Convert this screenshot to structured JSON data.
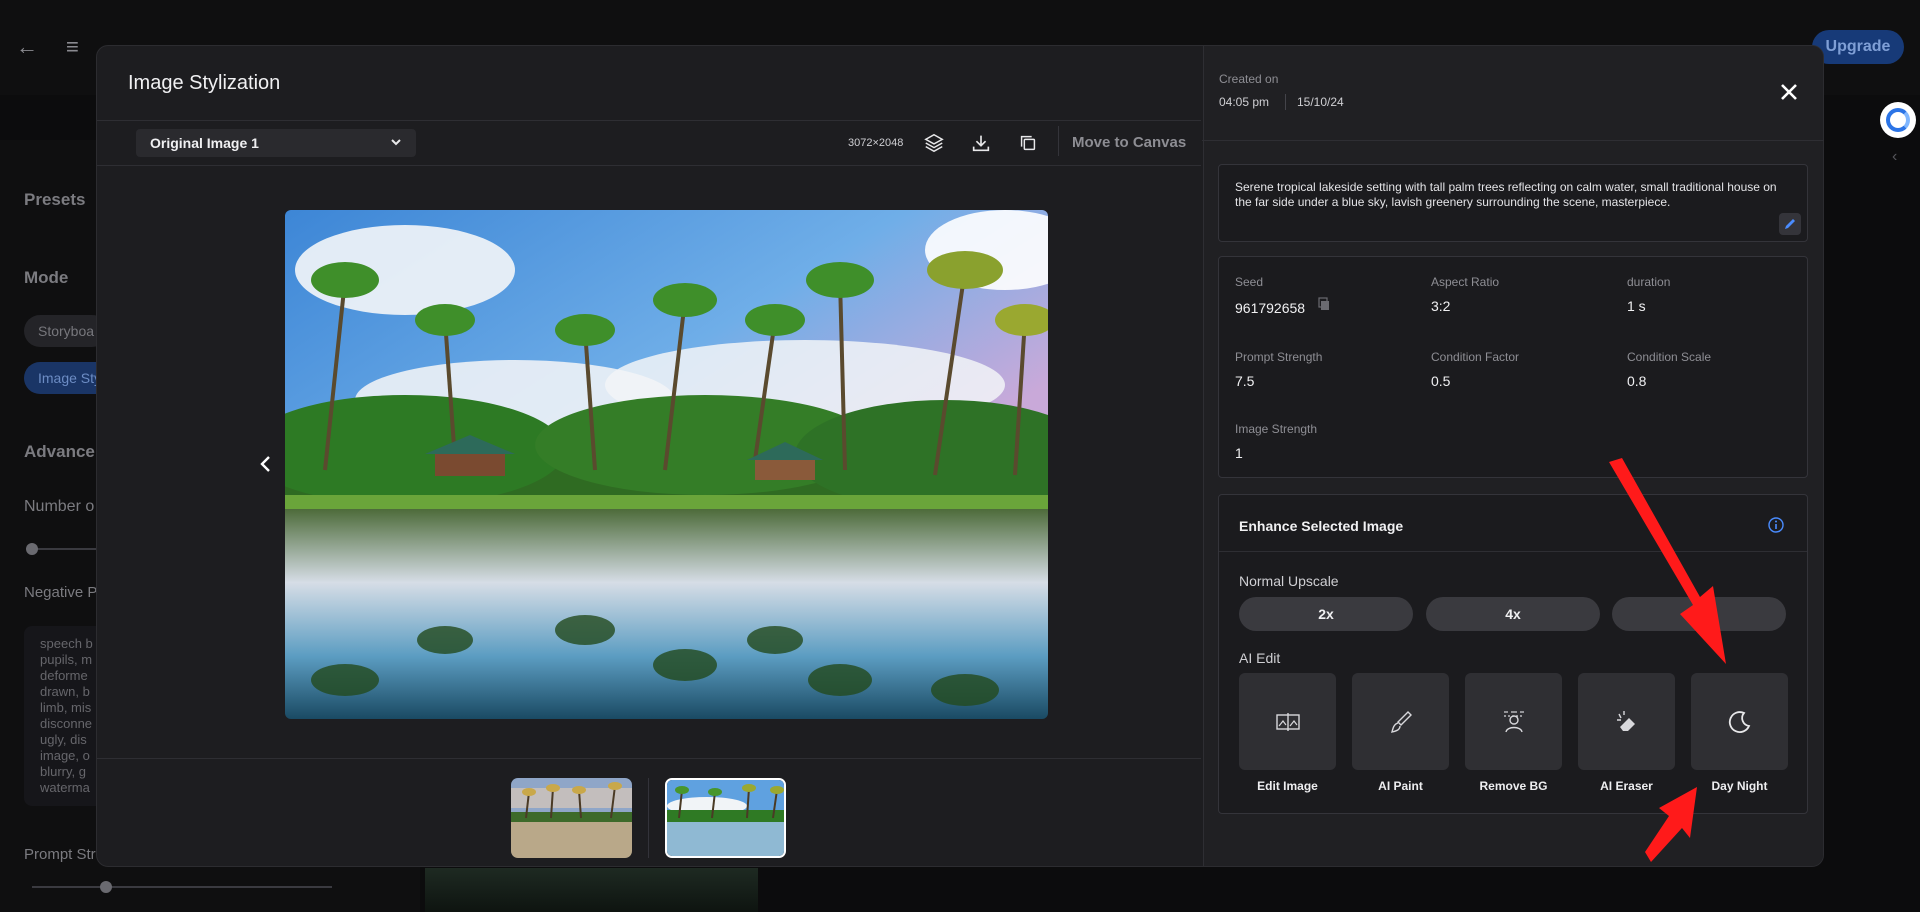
{
  "background": {
    "presets_label": "Presets",
    "mode_label": "Mode",
    "mode_storyboard": "Storyboa",
    "mode_image_stylization": "Image Sty",
    "advanced_label": "Advance",
    "number_label": "Number o",
    "negative_label": "Negative P",
    "negative_text": "speech b\npupils, m\ndeforme\ndrawn, b\nlimb, mis\ndisconne\nugly, dis\nimage, o\nblurry, g\nwaterma",
    "prompt_strength_label": "Prompt Str",
    "upgrade_label": "Upgrade",
    "accent": "#1f4aa0"
  },
  "modal": {
    "title": "Image Stylization",
    "image_selector": {
      "selected": "Original Image 1"
    },
    "dimensions": "3072×2048",
    "toolbar": {
      "layers_icon": "layers-icon",
      "download_icon": "download-icon",
      "copy_icon": "copy-icon",
      "move_to_canvas": "Move to Canvas"
    },
    "created": {
      "label": "Created on",
      "time": "04:05 pm",
      "date": "15/10/24"
    },
    "prompt": "Serene tropical lakeside setting with tall palm trees reflecting on calm water, small traditional house on the far side under a blue sky, lavish greenery surrounding the scene, masterpiece.",
    "params": {
      "seed_label": "Seed",
      "seed_value": "961792658",
      "aspect_label": "Aspect Ratio",
      "aspect_value": "3:2",
      "duration_label": "duration",
      "duration_value": "1 s",
      "prompt_strength_label": "Prompt Strength",
      "prompt_strength_value": "7.5",
      "condition_factor_label": "Condition Factor",
      "condition_factor_value": "0.5",
      "condition_scale_label": "Condition Scale",
      "condition_scale_value": "0.8",
      "image_strength_label": "Image Strength",
      "image_strength_value": "1"
    },
    "enhance": {
      "title": "Enhance Selected Image",
      "upscale_label": "Normal Upscale",
      "upscale_buttons": [
        "2x",
        "4x",
        ""
      ],
      "ai_edit_label": "AI Edit",
      "tools": [
        "Edit Image",
        "AI Paint",
        "Remove BG",
        "AI Eraser",
        "Day Night"
      ]
    },
    "colors": {
      "panel": "#1d1d20",
      "button": "#3a3a3f",
      "info_blue": "#4a8cff",
      "annotation_red": "#ff1a1a"
    }
  }
}
